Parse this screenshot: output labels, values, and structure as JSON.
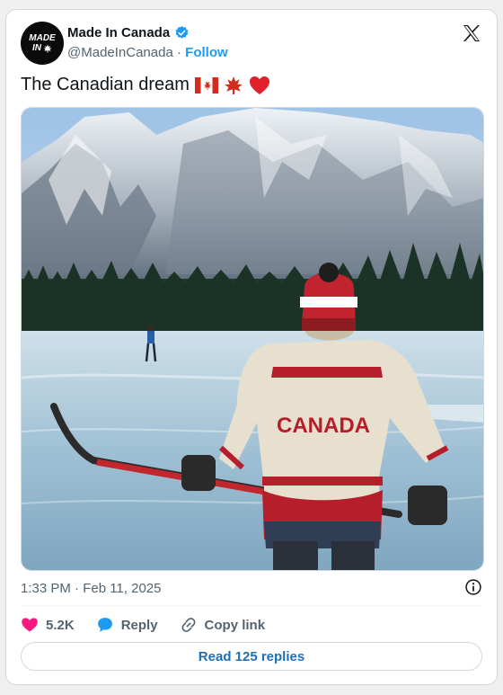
{
  "author": {
    "avatar_text_line1": "MADE",
    "avatar_text_line2": "IN",
    "name": "Made In Canada",
    "handle": "@MadeInCanada",
    "separator": "·",
    "follow_label": "Follow",
    "verified_icon": "verified-badge-icon"
  },
  "brand_icon": "x-logo-icon",
  "tweet": {
    "text": "The Canadian dream",
    "emojis": [
      "canada-flag-icon",
      "maple-leaf-icon",
      "red-heart-icon"
    ],
    "media_alt": "Person in a Canada sweater and toque holding a hockey stick on a frozen lake beneath snowy mountains",
    "sweater_text": "CANADA"
  },
  "meta": {
    "timestamp": "1:33 PM · Feb 11, 2025",
    "info_icon": "info-icon"
  },
  "actions": {
    "likes_count": "5.2K",
    "reply_label": "Reply",
    "copy_link_label": "Copy link"
  },
  "read_replies_label": "Read 125 replies",
  "colors": {
    "accent_blue": "#1d9bf0",
    "like_pink": "#f91880",
    "reply_blue": "#1d9bf0",
    "text_secondary": "#536471"
  }
}
